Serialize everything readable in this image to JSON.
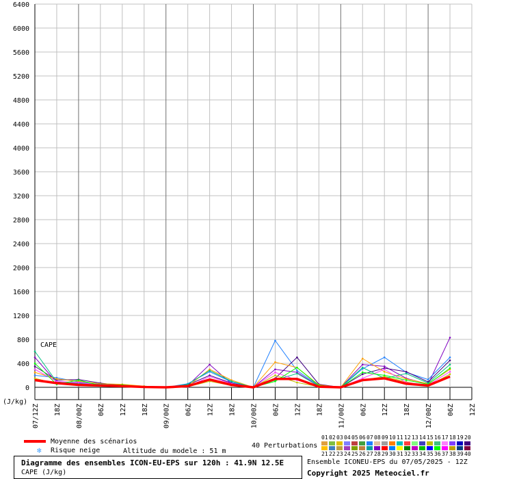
{
  "chart_data": {
    "type": "line",
    "title": "Diagramme des ensembles ICON-EU-EPS sur 120h : 41.9N 12.5E",
    "ylabel": "(J/kg)",
    "plot_label": "CAPE",
    "ylim": [
      0,
      6400
    ],
    "yticks": [
      0,
      400,
      800,
      1200,
      1600,
      2000,
      2400,
      2800,
      3200,
      3600,
      4000,
      4400,
      4800,
      5200,
      5600,
      6000,
      6400
    ],
    "x_hours": [
      0,
      6,
      12,
      18,
      24,
      30,
      36,
      42,
      48,
      54,
      60,
      66,
      72,
      78,
      84,
      90,
      96,
      102,
      108,
      114,
      120
    ],
    "xtick_labels": [
      "07/12Z",
      "18Z",
      "08/00Z",
      "06Z",
      "12Z",
      "18Z",
      "09/00Z",
      "06Z",
      "12Z",
      "18Z",
      "10/00Z",
      "06Z",
      "12Z",
      "18Z",
      "11/00Z",
      "06Z",
      "12Z",
      "18Z",
      "12/00Z",
      "06Z",
      "12Z"
    ],
    "day_boundary_hours": [
      12,
      36,
      60,
      84,
      108
    ],
    "mean_series": {
      "name": "Moyenne des scénarios",
      "color": "#ff0000",
      "values": [
        120,
        70,
        40,
        30,
        20,
        5,
        0,
        20,
        130,
        40,
        0,
        140,
        140,
        10,
        0,
        120,
        150,
        60,
        30,
        180
      ]
    },
    "series_hours": [
      0,
      6,
      12,
      18,
      24,
      30,
      36,
      42,
      48,
      54,
      60,
      66,
      72,
      78,
      84,
      90,
      96,
      102,
      108,
      114
    ],
    "series": [
      {
        "values": [
          500,
          80,
          70,
          40,
          30,
          10,
          0,
          30,
          380,
          60,
          0,
          300,
          250,
          20,
          0,
          380,
          350,
          150,
          50,
          830
        ]
      },
      {
        "values": [
          200,
          160,
          90,
          50,
          40,
          20,
          0,
          60,
          260,
          90,
          0,
          780,
          280,
          30,
          0,
          310,
          500,
          250,
          130,
          500
        ]
      },
      {
        "values": [
          350,
          120,
          130,
          70,
          30,
          10,
          0,
          40,
          200,
          70,
          0,
          150,
          500,
          50,
          0,
          220,
          320,
          260,
          90,
          450
        ]
      },
      {
        "values": [
          250,
          140,
          100,
          60,
          50,
          20,
          0,
          20,
          300,
          120,
          0,
          420,
          330,
          40,
          0,
          480,
          260,
          140,
          60,
          300
        ]
      },
      {
        "values": [
          150,
          60,
          40,
          20,
          20,
          5,
          0,
          10,
          100,
          30,
          0,
          200,
          80,
          10,
          0,
          120,
          180,
          90,
          20,
          220
        ]
      },
      {
        "values": [
          600,
          90,
          60,
          50,
          30,
          10,
          0,
          50,
          280,
          100,
          0,
          120,
          230,
          20,
          0,
          330,
          150,
          230,
          70,
          380
        ]
      },
      {
        "values": [
          300,
          100,
          80,
          40,
          20,
          5,
          0,
          10,
          180,
          60,
          0,
          250,
          120,
          15,
          0,
          150,
          300,
          80,
          40,
          260
        ]
      },
      {
        "values": [
          400,
          50,
          120,
          30,
          40,
          10,
          0,
          30,
          120,
          40,
          0,
          100,
          330,
          30,
          0,
          250,
          200,
          120,
          50,
          320
        ]
      }
    ],
    "series_colors": [
      "#8000c0",
      "#2080ff",
      "#400080",
      "#ffa000",
      "#c0c000",
      "#00c080",
      "#ff40ff",
      "#00ff00"
    ]
  },
  "legend": {
    "mean_label": "Moyenne des scénarios",
    "snow_label": "Risque neige",
    "altitude_label": "Altitude du modele : 51 m",
    "perturbations_label": "40 Perturbations",
    "ensemble_label": "Ensemble ICONEU-EPS du 07/05/2025 - 12Z",
    "copyright": "Copyright 2025 Meteociel.fr",
    "title_line1": "Diagramme des ensembles ICON-EU-EPS sur 120h : 41.9N 12.5E",
    "title_line2": "CAPE (J/kg)",
    "pert_numbers_row1": [
      "01",
      "02",
      "03",
      "04",
      "05",
      "06",
      "07",
      "08",
      "09",
      "10",
      "11",
      "12",
      "13",
      "14",
      "15",
      "16",
      "17",
      "18",
      "19",
      "20"
    ],
    "pert_numbers_row2": [
      "21",
      "22",
      "23",
      "24",
      "25",
      "26",
      "27",
      "28",
      "29",
      "30",
      "31",
      "32",
      "33",
      "34",
      "35",
      "36",
      "37",
      "38",
      "39",
      "40"
    ],
    "pert_colors_row1": [
      "#e0a040",
      "#80c040",
      "#e0c000",
      "#8080ff",
      "#c04040",
      "#40a040",
      "#2080ff",
      "#e0c0a0",
      "#a0a0a0",
      "#ff8000",
      "#00c0c0",
      "#ff4040",
      "#80ff80",
      "#4040c0",
      "#c0c000",
      "#40c080",
      "#ff80ff",
      "#8040ff",
      "#0000c0",
      "#400080"
    ],
    "pert_colors_row2": [
      "#ffc000",
      "#4080c0",
      "#c0a040",
      "#a040c0",
      "#80a000",
      "#c08040",
      "#00a0a0",
      "#8000c0",
      "#ff0000",
      "#0080ff",
      "#ffff00",
      "#008000",
      "#c000c0",
      "#00c000",
      "#0000ff",
      "#00ff00",
      "#ff00ff",
      "#c0a000",
      "#004080",
      "#800040"
    ]
  }
}
